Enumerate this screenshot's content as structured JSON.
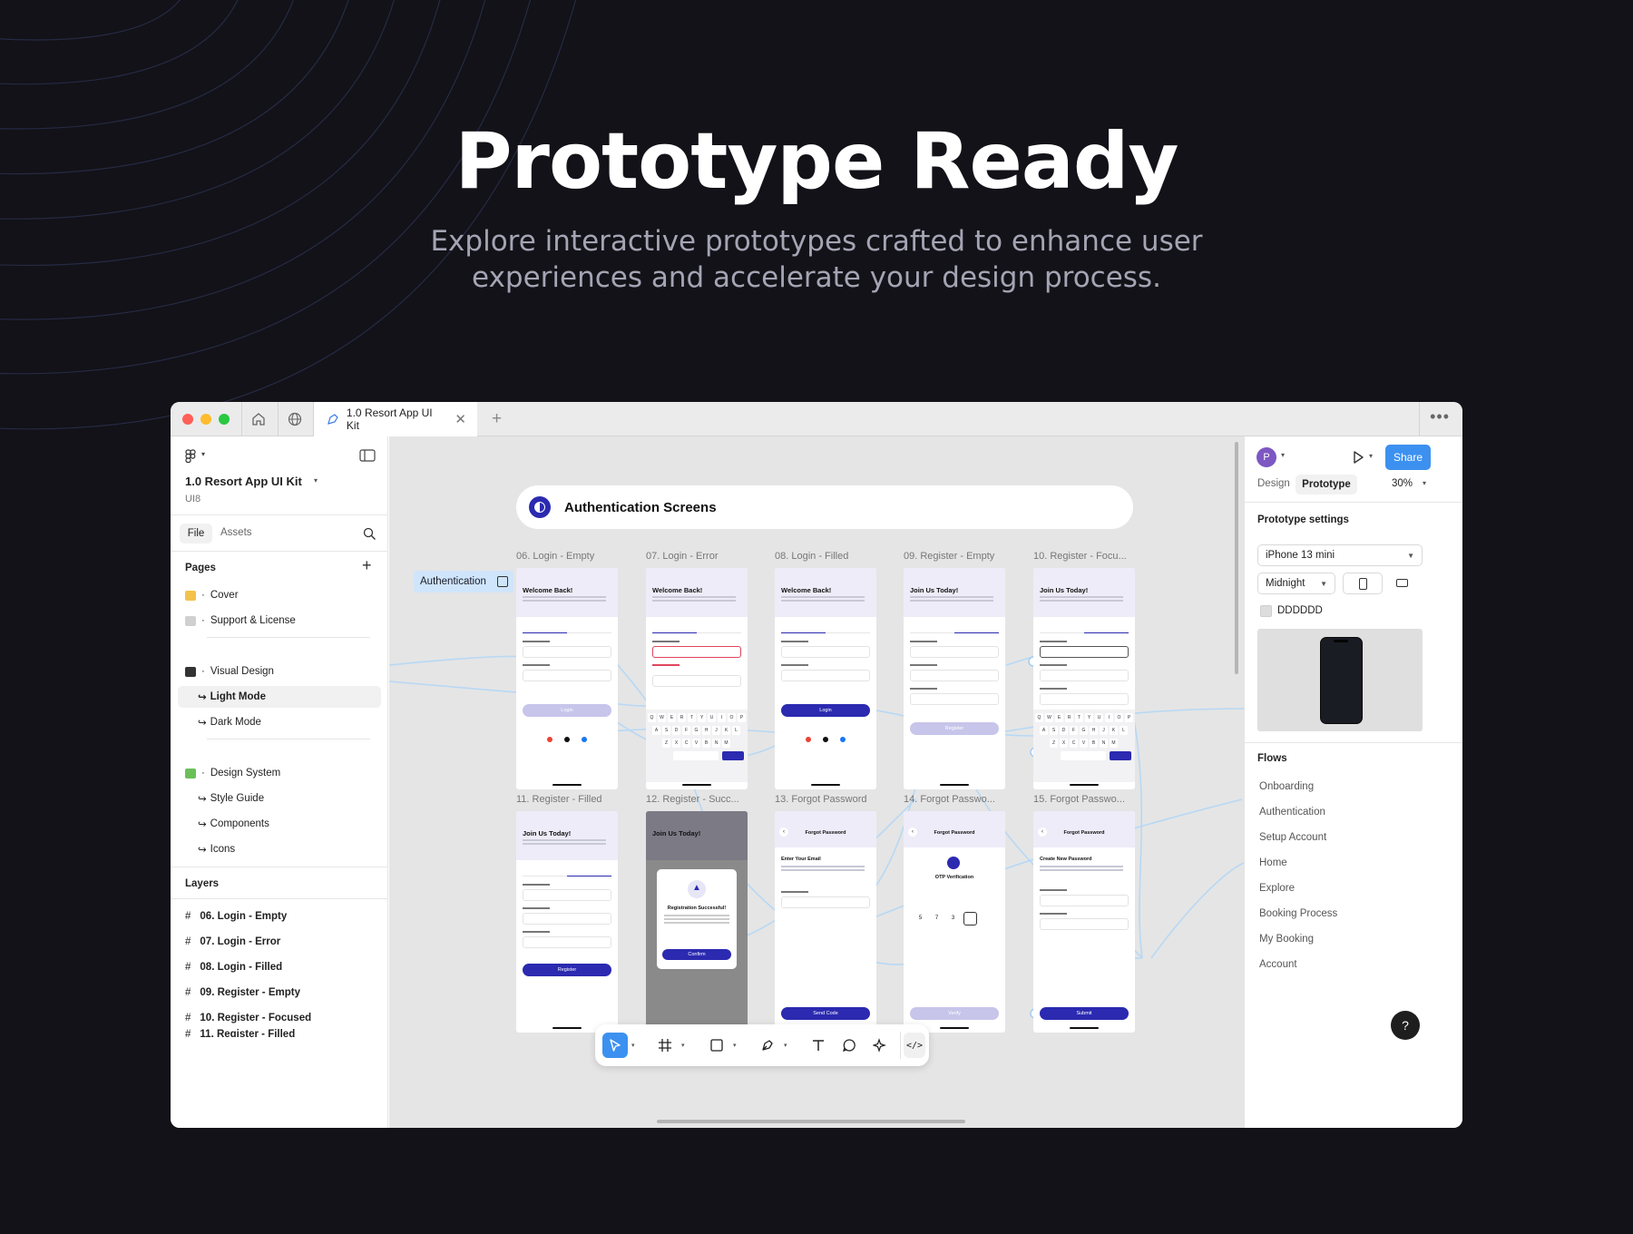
{
  "hero": {
    "title": "Prototype Ready",
    "subtitle": "Explore interactive prototypes crafted to enhance user experiences and accelerate your design process."
  },
  "window": {
    "tab_title": "1.0 Resort App UI Kit",
    "new_tab_icon": "plus-icon",
    "more_icon": "more-horizontal-icon"
  },
  "left_panel": {
    "file_name": "1.0 Resort App UI Kit",
    "team": "UI8",
    "tabs": [
      "File",
      "Assets"
    ],
    "pages_title": "Pages",
    "pages": [
      {
        "label": "Cover",
        "emoji_color": "#f3c24a"
      },
      {
        "label": "Support & License",
        "emoji_color": "#d0d0d0"
      },
      {
        "label": "Visual Design",
        "emoji_color": "#333333"
      },
      {
        "label": "Light Mode",
        "selected": true
      },
      {
        "label": "Dark Mode"
      },
      {
        "label": "Design System",
        "emoji_color": "#6bbf59"
      },
      {
        "label": "Style Guide"
      },
      {
        "label": "Components"
      },
      {
        "label": "Icons"
      }
    ],
    "layers_title": "Layers",
    "layers": [
      "06. Login - Empty",
      "07. Login - Error",
      "08. Login - Filled",
      "09. Register - Empty",
      "10. Register - Focused",
      "11. Register - Filled"
    ]
  },
  "canvas": {
    "section_title": "Authentication Screens",
    "flow_label": "Authentication",
    "frames_row1": [
      "06. Login - Empty",
      "07. Login - Error",
      "08. Login - Filled",
      "09. Register - Empty",
      "10. Register - Focu..."
    ],
    "frames_row2": [
      "11. Register - Filled",
      "12. Register - Succ...",
      "13. Forgot Password",
      "14. Forgot Passwo...",
      "15. Forgot Passwo..."
    ],
    "screen_titles": [
      "Welcome Back!",
      "Welcome Back!",
      "Welcome Back!",
      "Join Us Today!",
      "Join Us Today!",
      "Join Us Today!",
      "Join Us Today!",
      "Forgot Password",
      "Forgot Password",
      "Forgot Password"
    ],
    "buttons": [
      "Login",
      "Login",
      "Login",
      "Register",
      "",
      "Register",
      "Confirm",
      "Send Code",
      "Verify",
      "Submit"
    ],
    "success_text": "Registration Successful!",
    "otp_text": "OTP Verification",
    "enter_email": "Enter Your Email",
    "new_password": "Create New Password",
    "accent": "#2b2ab0"
  },
  "right_panel": {
    "avatar_letter": "P",
    "share_label": "Share",
    "tabs": [
      "Design",
      "Prototype"
    ],
    "zoom": "30%",
    "settings_title": "Prototype settings",
    "device": "iPhone 13 mini",
    "color_model": "Midnight",
    "bg_color": "DDDDDD",
    "flows_title": "Flows",
    "flows": [
      "Onboarding",
      "Authentication",
      "Setup Account",
      "Home",
      "Explore",
      "Booking Process",
      "My Booking",
      "Account"
    ],
    "help_label": "?"
  }
}
